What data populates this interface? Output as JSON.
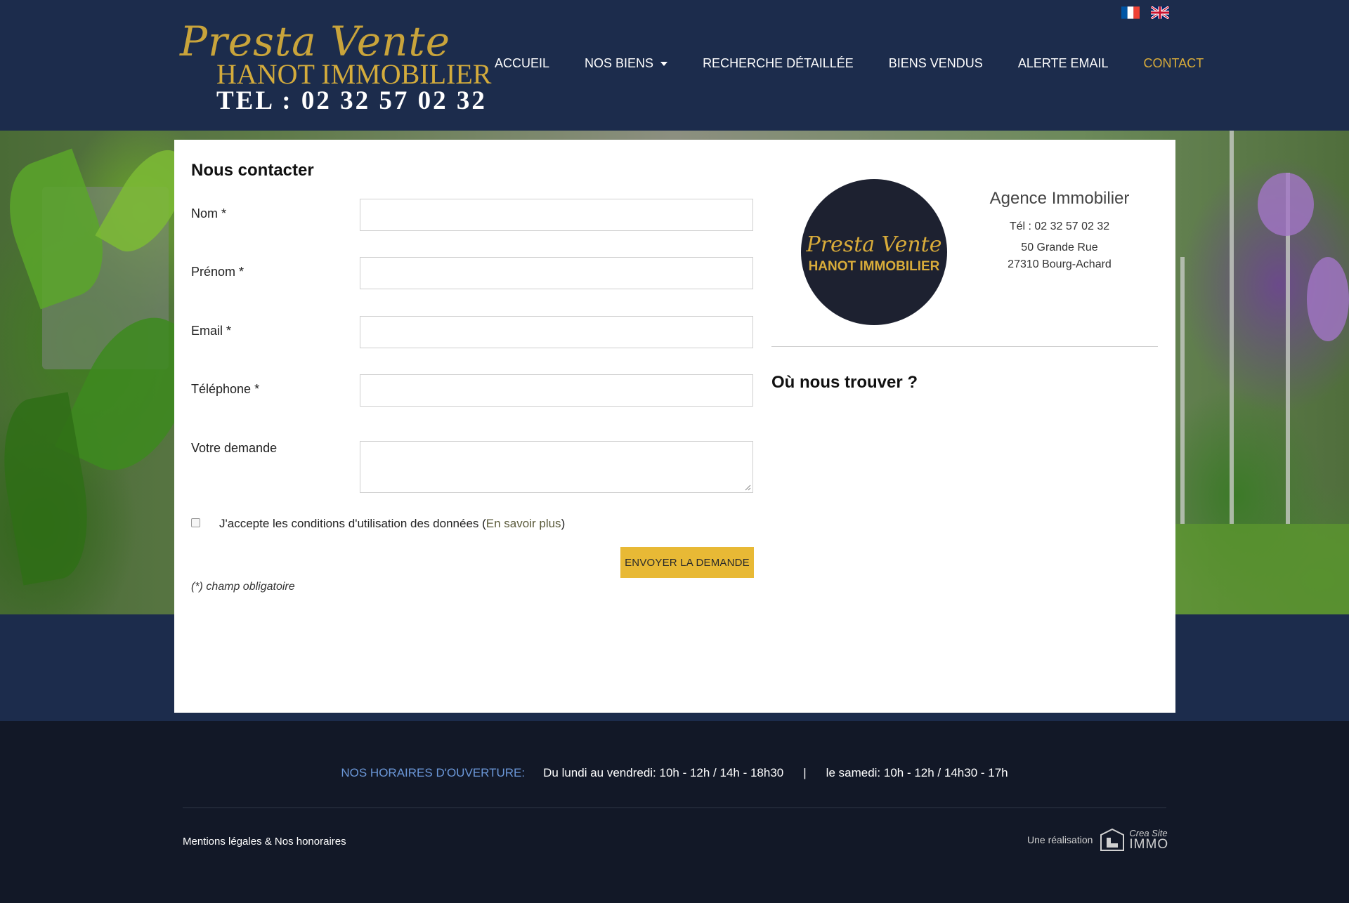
{
  "header": {
    "logo": {
      "script": "Presta Vente",
      "name": "HANOT IMMOBILIER",
      "tel": "TEL : 02 32 57 02 32"
    },
    "flags": [
      {
        "name": "french-flag-icon",
        "colors": [
          "#0055a4",
          "#ffffff",
          "#ef4135"
        ]
      },
      {
        "name": "uk-flag-icon",
        "colors": [
          "#012169",
          "#ffffff",
          "#c8102e"
        ]
      }
    ],
    "nav": [
      {
        "label": "ACCUEIL",
        "active": false
      },
      {
        "label": "NOS BIENS",
        "active": false,
        "dropdown": true
      },
      {
        "label": "RECHERCHE DÉTAILLÉE",
        "active": false
      },
      {
        "label": "BIENS VENDUS",
        "active": false
      },
      {
        "label": "ALERTE EMAIL",
        "active": false
      },
      {
        "label": "CONTACT",
        "active": true
      }
    ]
  },
  "form": {
    "title": "Nous contacter",
    "fields": [
      {
        "label": "Nom *",
        "value": ""
      },
      {
        "label": "Prénom *",
        "value": ""
      },
      {
        "label": "Email *",
        "value": ""
      },
      {
        "label": "Téléphone *",
        "value": ""
      },
      {
        "label": "Votre demande",
        "value": ""
      }
    ],
    "consent_text": "J'accepte les conditions d'utilisation des données (",
    "consent_link": "En savoir plus",
    "consent_close": ")",
    "consent_checked": false,
    "submit_label": "ENVOYER LA DEMANDE",
    "required_note": "(*) champ obligatoire"
  },
  "agency": {
    "logo_script": "Presta Vente",
    "logo_name": "HANOT IMMOBILIER",
    "name": "Agence Immobilier",
    "tel": "Tél : 02 32 57 02 32",
    "address_line1": "50 Grande Rue",
    "address_line2": "27310 Bourg-Achard",
    "find_title": "Où nous trouver ?"
  },
  "footer": {
    "hours_label": "NOS HORAIRES D'OUVERTURE:",
    "weekday_hours": "Du lundi au vendredi: 10h - 12h / 14h - 18h30",
    "separator": "|",
    "saturday_hours": "le samedi: 10h - 12h / 14h30 - 17h",
    "legal_link": "Mentions légales & Nos honoraires",
    "credit_prefix": "Une réalisation",
    "credit_brand_top": "Crea Site",
    "credit_brand_bottom": "IMMO"
  },
  "colors": {
    "navy": "#1c2c4c",
    "footer_bg": "#121827",
    "gold": "#d9ac3a",
    "button": "#e8b935",
    "hours_label": "#6b97d8"
  }
}
